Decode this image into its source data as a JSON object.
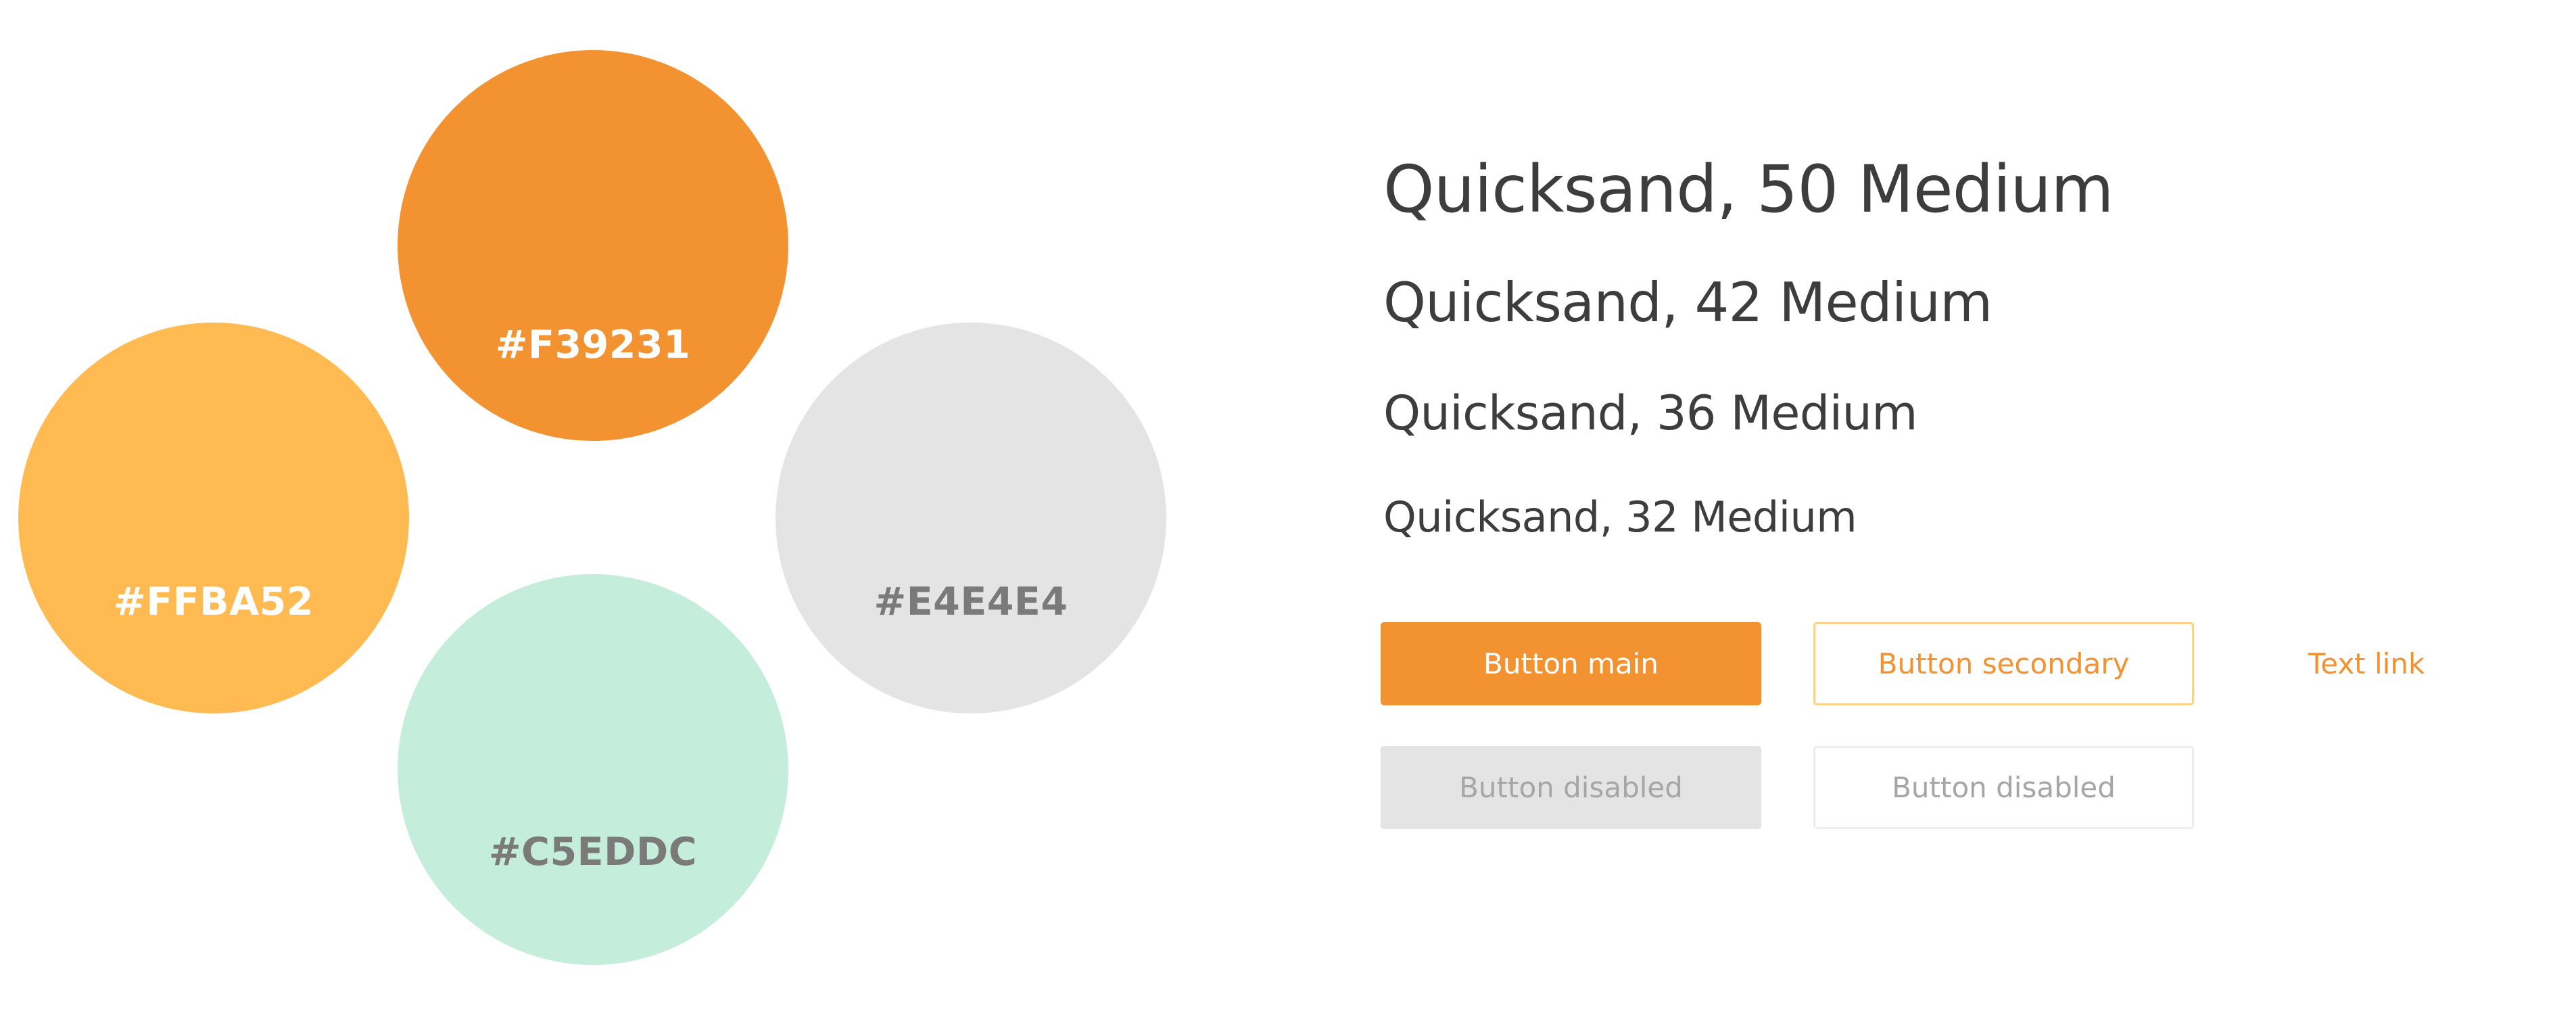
{
  "palette": {
    "swatches": [
      {
        "name": "orange",
        "hex": "#F39231",
        "label": "#F39231",
        "label_color": "#FFFFFF"
      },
      {
        "name": "yellow",
        "hex": "#FFBA52",
        "label": "#FFBA52",
        "label_color": "#FFFFFF"
      },
      {
        "name": "grey",
        "hex": "#E4E4E4",
        "label": "#E4E4E4",
        "label_color": "#7A7A7A"
      },
      {
        "name": "mint",
        "hex": "#C5EDDC",
        "label": "#C5EDDC",
        "label_color": "#7A7A7A"
      }
    ]
  },
  "typography": {
    "samples": [
      {
        "text": "Quicksand, 50 Medium"
      },
      {
        "text": "Quicksand, 42 Medium"
      },
      {
        "text": "Quicksand, 36 Medium"
      },
      {
        "text": "Quicksand, 32 Medium"
      }
    ],
    "text_color": "#3D3D3D"
  },
  "buttons": {
    "main": {
      "label": "Button main",
      "enabled": true
    },
    "secondary": {
      "label": "Button secondary",
      "enabled": true
    },
    "text_link": {
      "label": "Text link",
      "enabled": true
    },
    "disabled_filled": {
      "label": "Button disabled",
      "enabled": false
    },
    "disabled_outline": {
      "label": "Button disabled",
      "enabled": false
    }
  },
  "colors": {
    "accent": "#F39231",
    "secondary_border": "#FFD08A",
    "disabled_bg": "#E4E4E4",
    "disabled_text": "#A6A6A6"
  }
}
